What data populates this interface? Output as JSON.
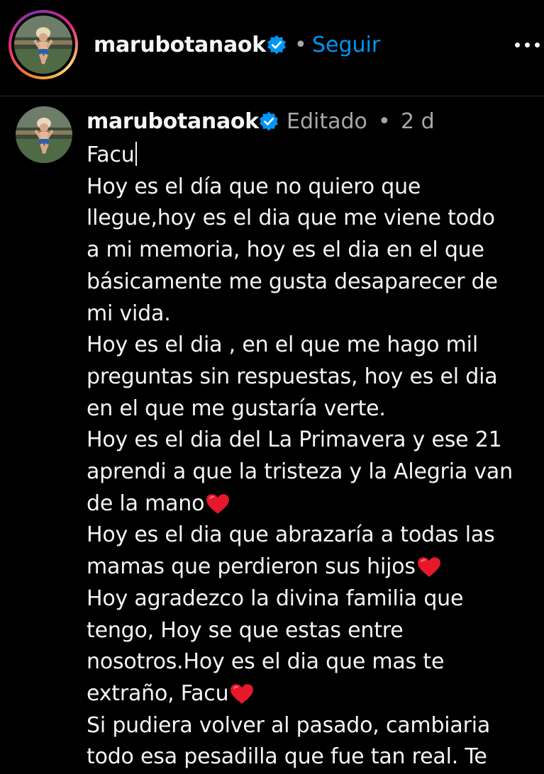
{
  "header": {
    "username": "marubotanaok",
    "separator": "•",
    "follow_label": "Seguir",
    "avatar_icon": "profile-photo-icon",
    "verified_icon": "verified-badge-icon",
    "more_icon": "more-options-icon"
  },
  "comment": {
    "username": "marubotanaok",
    "edited_label": "Editado",
    "separator": "•",
    "time": "2 d",
    "lines": [
      "Facu",
      "Hoy es el día que no quiero que",
      "llegue,hoy es el dia que me viene todo",
      "a mi memoria, hoy es el dia en el que",
      "básicamente me gusta desaparecer de",
      "mi vida.",
      "Hoy es el dia , en el que me hago mil",
      "preguntas sin respuestas, hoy es el dia",
      "en el que me gustaría verte.",
      "Hoy es el dia del La Primavera y ese 21",
      "aprendi a que la tristeza y la Alegria van",
      "de la mano",
      "Hoy es el dia que abrazaría a todas las",
      "mamas que perdieron sus hijos",
      "Hoy agradezco la divina familia que",
      "tengo, Hoy se que estas entre",
      "nosotros.Hoy es el dia que mas te",
      "extraño, Facu",
      "Si pudiera volver al pasado, cambiaria",
      "todo esa pesadilla que fue tan real. Te"
    ]
  },
  "colors": {
    "background": "#000000",
    "text": "#f5f5f5",
    "secondary": "#a8a8a8",
    "link": "#0095f6",
    "heart": "#e8172b",
    "verified": "#0095f6"
  }
}
